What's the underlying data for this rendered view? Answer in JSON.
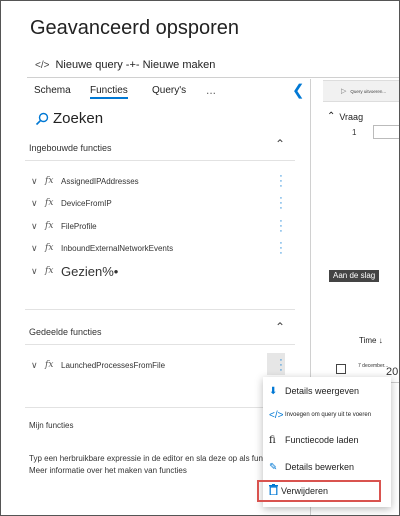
{
  "header": {
    "title": "Geavanceerd opsporen",
    "query_tab": "Nieuwe query -+- Nieuwe maken"
  },
  "tabs": [
    {
      "label": "Schema"
    },
    {
      "label": "Functies",
      "active": true
    },
    {
      "label": "Query's"
    },
    {
      "label": "..."
    }
  ],
  "search": {
    "label": "Zoeken"
  },
  "builtin": {
    "heading": "Ingebouwde functies",
    "items": [
      {
        "name": "AssignedIPAddresses"
      },
      {
        "name": "DeviceFromIP"
      },
      {
        "name": "FileProfile"
      },
      {
        "name": "InboundExternalNetworkEvents"
      },
      {
        "name": "Gezien%•"
      }
    ]
  },
  "shared": {
    "heading": "Gedeelde functies",
    "items": [
      {
        "name": "LaunchedProcessesFromFile"
      }
    ]
  },
  "mine": {
    "heading": "Mijn functies",
    "hint": "Typ een herbruikbare expressie in de editor en sla deze op als functie. Meer informatie over het maken van functies"
  },
  "right_panel": {
    "toolbar_text": "Query uitvoeren...",
    "query_label": "Vraag",
    "line_number": "1",
    "aan_de_slag": "Aan de slag",
    "time_header": "Time ↓",
    "row_date": "7 december...",
    "row_year": "20"
  },
  "context_menu": {
    "items": [
      {
        "label": "Details weergeven",
        "icon": "details-icon"
      },
      {
        "label": "Invoegen om query uit te voeren",
        "icon": "insert-code-icon"
      },
      {
        "label": "Functiecode laden",
        "icon": "function-icon"
      },
      {
        "label": "Details bewerken",
        "icon": "edit-icon"
      },
      {
        "label": "Verwijderen",
        "icon": "trash-icon"
      }
    ]
  },
  "colors": {
    "accent": "#0078d4",
    "highlight_border": "#d9534f"
  }
}
